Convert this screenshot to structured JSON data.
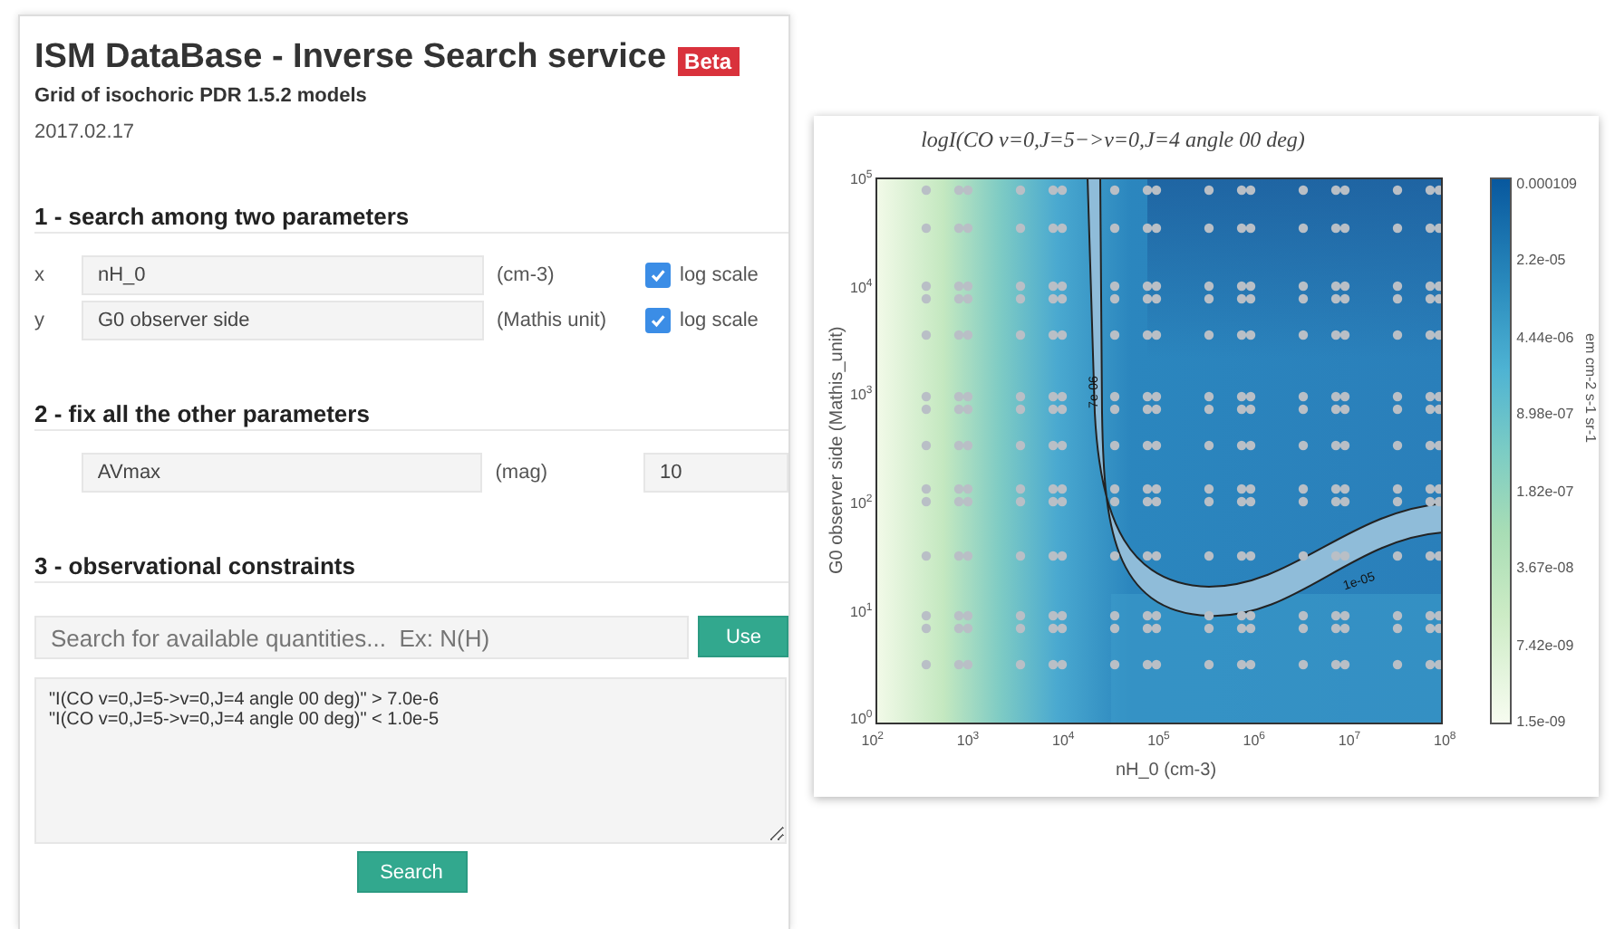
{
  "header": {
    "title": "ISM DataBase - Inverse Search service",
    "badge": "Beta",
    "subtitle": "Grid of isochoric PDR 1.5.2 models",
    "date": "2017.02.17"
  },
  "section_1": {
    "heading": "1 - search among two parameters",
    "rows": [
      {
        "axis": "x",
        "parameter": "nH_0",
        "unit": "(cm-3)",
        "option": "log scale",
        "checked": true
      },
      {
        "axis": "y",
        "parameter": "G0 observer side",
        "unit": "(Mathis unit)",
        "option": "log scale",
        "checked": true
      }
    ]
  },
  "section_2": {
    "heading": "2 - fix all the other parameters",
    "rows": [
      {
        "parameter": "AVmax",
        "unit": "(mag)",
        "value": "10"
      }
    ]
  },
  "section_3": {
    "heading": "3 - observational constraints",
    "search": {
      "placeholder": "Search for available quantities...  Ex: N(H)"
    },
    "use_button": "Use",
    "constraints": [
      "\"I(CO v=0,J=5->v=0,J=4 angle 00 deg)\" > 7.0e-6",
      "\"I(CO v=0,J=5->v=0,J=4 angle 00 deg)\" < 1.0e-5"
    ],
    "search_button": "Search"
  },
  "plot": {
    "title": "logI(CO v=0,J=5−>v=0,J=4 angle 00 deg)",
    "y_label": "G0 observer side (Mathis_unit)",
    "x_label": "nH_0 (cm-3)",
    "x_ticks": [
      "10$^{2}$",
      "10$^{3}$",
      "10$^{4}$",
      "10$^{5}$",
      "10$^{6}$",
      "10$^{7}$",
      "10$^{8}$"
    ],
    "y_ticks": [
      "10$^{5}$",
      "10$^{4}$",
      "10$^{3}$",
      "10$^{2}$",
      "10$^{1}$",
      "10$^{0}$"
    ],
    "colorbar_ticks": [
      "0.000109",
      "2.2e-05",
      "4.44e-06",
      "8.98e-07",
      "1.82e-07",
      "3.67e-08",
      "7.42e-09",
      "1.5e-09"
    ],
    "colorbar_label": "em cm-2 s-1 sr-1",
    "contour_labels": [
      "7e-06",
      "1e-05"
    ]
  }
}
